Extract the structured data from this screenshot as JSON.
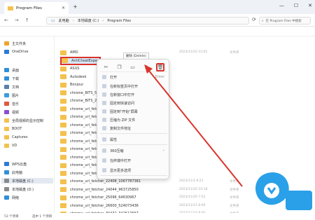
{
  "window": {
    "tab_title": "Program Files",
    "close_glyph": "✕",
    "add_glyph": "+",
    "controls": [
      "—",
      "☐",
      "✕"
    ]
  },
  "toolbar": {
    "back": "←",
    "forward": "→",
    "up": "↑",
    "refresh": "⟳",
    "breadcrumb": [
      "此电脑",
      "本地磁盘 (C:)",
      "Program Files"
    ],
    "search_placeholder": "在 Program Files 中搜索"
  },
  "sidebar": {
    "items": [
      {
        "label": "主文件夹",
        "icon": "home-icon",
        "color": "#f0a42b"
      },
      {
        "label": "OneDrive",
        "icon": "cloud-icon",
        "color": "#2b7bd4"
      },
      {
        "label": "桌面",
        "icon": "desktop-icon",
        "color": "#2f8fd8"
      },
      {
        "label": "下载",
        "icon": "download-icon",
        "color": "#2f8fd8"
      },
      {
        "label": "文档",
        "icon": "document-icon",
        "color": "#5a7fa8"
      },
      {
        "label": "图片",
        "icon": "picture-icon",
        "color": "#3d9be0"
      },
      {
        "label": "音乐",
        "icon": "music-icon",
        "color": "#e0583d"
      },
      {
        "label": "视频",
        "icon": "video-icon",
        "color": "#8a4fd0"
      },
      {
        "label": "全局视频的显示控制",
        "icon": "folder-icon",
        "color": "#f4c04e"
      },
      {
        "label": "BOOT",
        "icon": "folder-icon",
        "color": "#f4c04e"
      },
      {
        "label": "Captures",
        "icon": "folder-icon",
        "color": "#f4c04e"
      },
      {
        "label": "VD",
        "icon": "folder-icon",
        "color": "#f4c04e"
      },
      {
        "label": "WPS云盘",
        "icon": "cloud-icon",
        "color": "#2b7bd4"
      },
      {
        "label": "此电脑",
        "icon": "computer-icon",
        "color": "#2f8fd8"
      },
      {
        "label": "本地磁盘 (C:)",
        "icon": "drive-icon",
        "color": "#8a8a8a"
      },
      {
        "label": "本地磁盘 (D:)",
        "icon": "drive-icon",
        "color": "#8a8a8a"
      },
      {
        "label": "网络",
        "icon": "network-icon",
        "color": "#2f8fd8"
      }
    ]
  },
  "files": [
    {
      "name": "AMD",
      "date": "2023/11/10 15:01",
      "type": "文件夹"
    },
    {
      "name": "AntiCheatExpert",
      "date": "",
      "type": ""
    },
    {
      "name": "ASUS",
      "date": "",
      "type": ""
    },
    {
      "name": "Autodesk",
      "date": "",
      "type": ""
    },
    {
      "name": "Bonjour",
      "date": "",
      "type": ""
    },
    {
      "name": "chrome_BITS_5048",
      "date": "",
      "type": ""
    },
    {
      "name": "chrome_BITS_22560",
      "date": "",
      "type": ""
    },
    {
      "name": "chrome_url_fetcher",
      "date": "",
      "type": ""
    },
    {
      "name": "chrome_url_fetcher",
      "date": "",
      "type": ""
    },
    {
      "name": "chrome_url_fetcher",
      "date": "",
      "type": ""
    },
    {
      "name": "chrome_url_fetcher",
      "date": "",
      "type": ""
    },
    {
      "name": "chrome_url_fetcher",
      "date": "",
      "type": ""
    },
    {
      "name": "chrome_url_fetcher",
      "date": "",
      "type": ""
    },
    {
      "name": "chrome_url_fetcher",
      "date": "",
      "type": ""
    },
    {
      "name": "chrome_url_fetcher",
      "date": "",
      "type": ""
    },
    {
      "name": "chrome_url_fetcher",
      "date": "",
      "type": ""
    },
    {
      "name": "chrome_url_fetcher_22408_1067787381",
      "date": "2023/11/2 8:21",
      "type": "文件夹"
    },
    {
      "name": "chrome_url_fetcher_24044_963725850",
      "date": "2023/11/20 10:18",
      "type": "文件夹"
    },
    {
      "name": "chrome_url_fetcher_25096_64630967",
      "date": "2023/11/20 7:52",
      "type": "文件夹"
    },
    {
      "name": "chrome_url_fetcher_26600_524073436",
      "date": "2023/11/15 8:00",
      "type": "文件夹"
    },
    {
      "name": "chrome_url_fetcher_30432_342517667",
      "date": "2023/11/10 8:00",
      "type": "文件夹"
    }
  ],
  "tooltip": "删除 (Delete)",
  "context_menu": {
    "items": [
      {
        "label": "打开",
        "shortcut": "Enter"
      },
      {
        "label": "在新标签页中打开"
      },
      {
        "label": "在新窗口中打开"
      },
      {
        "label": "固定到快速访问"
      },
      {
        "label": "固定到\"开始\"屏幕"
      },
      {
        "label": "压缩为 ZIP 文件"
      },
      {
        "label": "复制文件地址"
      },
      {
        "label": "属性"
      },
      {
        "label": "360压缩",
        "submenu": true
      },
      {
        "label": "在终端中打开"
      },
      {
        "label": "显示更多选项"
      }
    ]
  },
  "status": {
    "count": "53 个项目",
    "selected": "选中 1 个项目"
  },
  "colors": {
    "highlight_red": "#d9342b",
    "folder_yellow": "#f4c04e",
    "watermark_blue": "#2aa0e8"
  }
}
